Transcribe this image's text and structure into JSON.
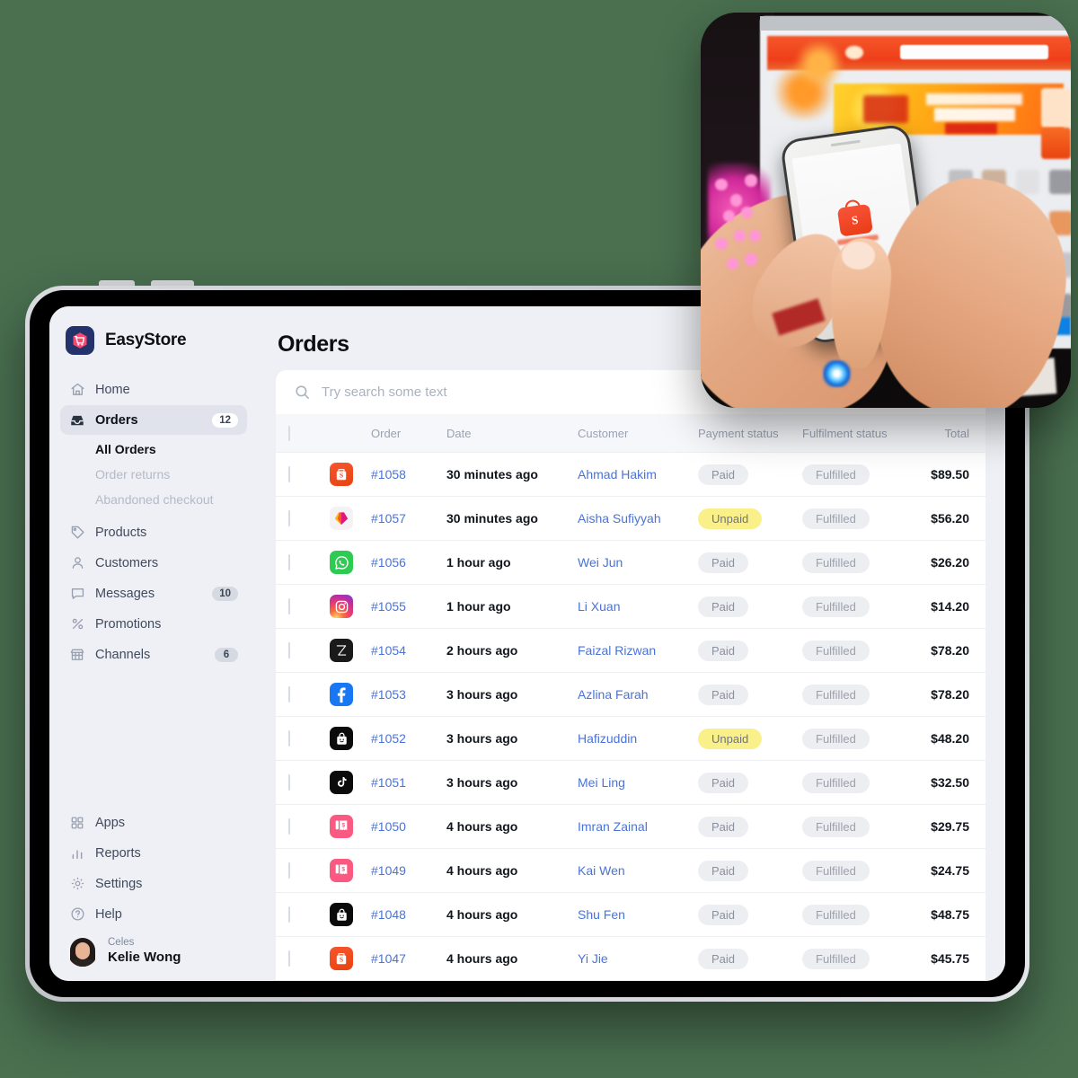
{
  "brand": {
    "name": "EasyStore",
    "logo_icon": "shopping-cart-badge-icon"
  },
  "sidebar": {
    "nav": [
      {
        "label": "Home",
        "icon": "home-icon",
        "badge": null,
        "active": false
      },
      {
        "label": "Orders",
        "icon": "inbox-icon",
        "badge": "12",
        "active": true
      },
      {
        "label": "Products",
        "icon": "tag-icon",
        "badge": null,
        "active": false
      },
      {
        "label": "Customers",
        "icon": "person-icon",
        "badge": null,
        "active": false
      },
      {
        "label": "Messages",
        "icon": "chat-icon",
        "badge": "10",
        "active": false
      },
      {
        "label": "Promotions",
        "icon": "percent-icon",
        "badge": null,
        "active": false
      },
      {
        "label": "Channels",
        "icon": "store-icon",
        "badge": "6",
        "active": false
      }
    ],
    "orders_subnav": [
      {
        "label": "All Orders",
        "current": true
      },
      {
        "label": "Order returns",
        "current": false
      },
      {
        "label": "Abandoned checkout",
        "current": false
      }
    ],
    "footer_nav": [
      {
        "label": "Apps",
        "icon": "grid-icon"
      },
      {
        "label": "Reports",
        "icon": "bar-chart-icon"
      },
      {
        "label": "Settings",
        "icon": "gear-icon"
      },
      {
        "label": "Help",
        "icon": "question-circle-icon"
      }
    ],
    "user": {
      "org": "Celes",
      "name": "Kelie Wong",
      "avatar": "user-avatar-photo"
    }
  },
  "main": {
    "page_title": "Orders",
    "search": {
      "placeholder": "Try search some text",
      "value": "",
      "icon": "search-icon"
    },
    "table": {
      "columns": [
        "",
        "",
        "Order",
        "Date",
        "Customer",
        "Payment status",
        "Fulfilment status",
        "Total"
      ],
      "rows": [
        {
          "channel": "shopee",
          "order": "#1058",
          "date": "30 minutes ago",
          "customer": "Ahmad Hakim",
          "payment": "Paid",
          "fulfilment": "Fulfilled",
          "total": "$89.50"
        },
        {
          "channel": "lazada",
          "order": "#1057",
          "date": "30 minutes ago",
          "customer": "Aisha Sufiyyah",
          "payment": "Unpaid",
          "fulfilment": "Fulfilled",
          "total": "$56.20"
        },
        {
          "channel": "whatsapp",
          "order": "#1056",
          "date": "1 hour ago",
          "customer": "Wei Jun",
          "payment": "Paid",
          "fulfilment": "Fulfilled",
          "total": "$26.20"
        },
        {
          "channel": "instagram",
          "order": "#1055",
          "date": "1 hour ago",
          "customer": "Li Xuan",
          "payment": "Paid",
          "fulfilment": "Fulfilled",
          "total": "$14.20"
        },
        {
          "channel": "zalora",
          "order": "#1054",
          "date": "2 hours ago",
          "customer": "Faizal Rizwan",
          "payment": "Paid",
          "fulfilment": "Fulfilled",
          "total": "$78.20"
        },
        {
          "channel": "facebook",
          "order": "#1053",
          "date": "3 hours ago",
          "customer": "Azlina Farah",
          "payment": "Paid",
          "fulfilment": "Fulfilled",
          "total": "$78.20"
        },
        {
          "channel": "shopbag",
          "order": "#1052",
          "date": "3 hours ago",
          "customer": "Hafizuddin",
          "payment": "Unpaid",
          "fulfilment": "Fulfilled",
          "total": "$48.20"
        },
        {
          "channel": "tiktok",
          "order": "#1051",
          "date": "3 hours ago",
          "customer": "Mei Ling",
          "payment": "Paid",
          "fulfilment": "Fulfilled",
          "total": "$32.50"
        },
        {
          "channel": "receipt",
          "order": "#1050",
          "date": "4 hours ago",
          "customer": "Imran Zainal",
          "payment": "Paid",
          "fulfilment": "Fulfilled",
          "total": "$29.75"
        },
        {
          "channel": "receipt",
          "order": "#1049",
          "date": "4 hours ago",
          "customer": "Kai Wen",
          "payment": "Paid",
          "fulfilment": "Fulfilled",
          "total": "$24.75"
        },
        {
          "channel": "shopbag",
          "order": "#1048",
          "date": "4 hours ago",
          "customer": "Shu Fen",
          "payment": "Paid",
          "fulfilment": "Fulfilled",
          "total": "$48.75"
        },
        {
          "channel": "shopee",
          "order": "#1047",
          "date": "4 hours ago",
          "customer": "Yi Jie",
          "payment": "Paid",
          "fulfilment": "Fulfilled",
          "total": "$45.75"
        }
      ]
    }
  },
  "overlay_photo": {
    "description": "Hands holding a smartphone showing the Shopee app in front of a computer monitor displaying an orange e-commerce storefront"
  },
  "colors": {
    "page_background": "#4a7050",
    "sidebar_background": "#eef0f5",
    "link_blue": "#4a73d6",
    "unpaid_yellow": "#faf089",
    "pill_gray": "#eceef2",
    "brand_navy": "#24326b",
    "brand_pink": "#f6486e"
  }
}
